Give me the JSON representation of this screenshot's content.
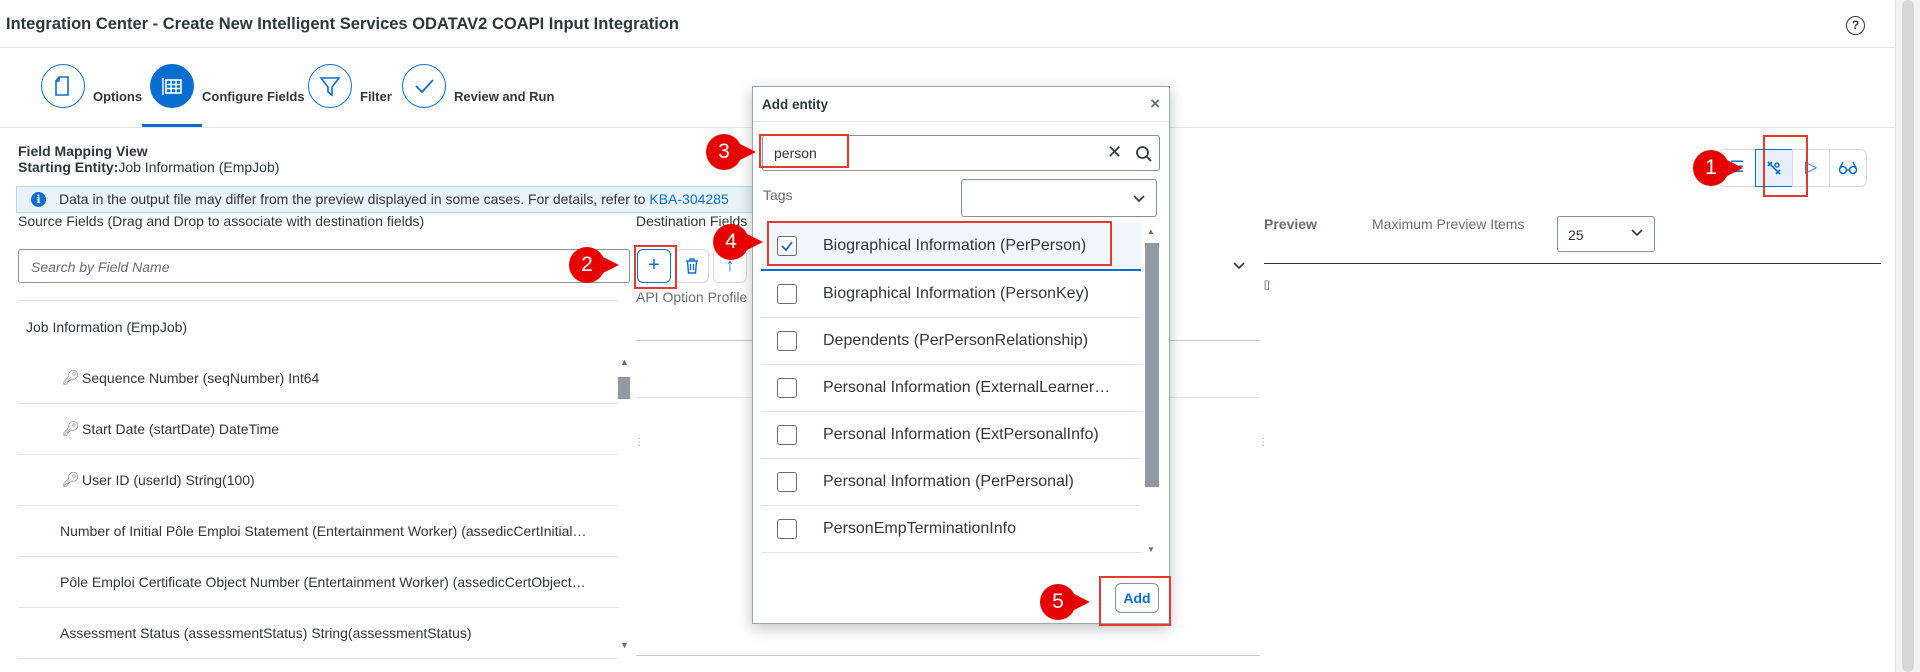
{
  "header": {
    "title": "Integration Center - Create New Intelligent Services ODATAV2 COAPI Input Integration",
    "help_glyph": "?"
  },
  "steps": [
    {
      "label": "Options",
      "icon": "document-icon"
    },
    {
      "label": "Configure Fields",
      "icon": "grid-icon",
      "active": true
    },
    {
      "label": "Filter",
      "icon": "filter-icon"
    },
    {
      "label": "Review and Run",
      "icon": "checkmark-icon"
    }
  ],
  "field_mapping": {
    "title": "Field Mapping View",
    "entity_label": "Starting Entity:",
    "entity_value": "Job Information (EmpJob)",
    "info_text": "Data in the output file may differ from the preview displayed in some cases. For details, refer to ",
    "info_link": "KBA-304285"
  },
  "source": {
    "header": "Source Fields (Drag and Drop to associate with destination fields)",
    "search_placeholder": "Search by Field Name",
    "table_title": "Job Information (EmpJob)",
    "rows": [
      {
        "text": "Sequence Number (seqNumber) Int64",
        "key": true
      },
      {
        "text": "Start Date (startDate) DateTime",
        "key": true
      },
      {
        "text": "User ID (userId) String(100)",
        "key": true
      },
      {
        "text": "Number of Initial Pôle Emploi Statement (Entertainment Worker) (assedicCertInitial…",
        "key": false
      },
      {
        "text": "Pôle Emploi Certificate Object Number (Entertainment Worker) (assedicCertObject…",
        "key": false
      },
      {
        "text": "Assessment Status (assessmentStatus) String(assessmentStatus)",
        "key": false
      }
    ]
  },
  "destination": {
    "header": "Destination Fields",
    "api_label": "API Option Profile"
  },
  "preview": {
    "title": "Preview",
    "max_label": "Maximum Preview Items",
    "max_value": "25",
    "empty": "[]"
  },
  "dialog": {
    "title": "Add entity",
    "search_value": "person",
    "tags_label": "Tags",
    "items": [
      {
        "label": "Biographical Information (PerPerson)",
        "checked": true
      },
      {
        "label": "Biographical Information (PersonKey)",
        "checked": false
      },
      {
        "label": "Dependents (PerPersonRelationship)",
        "checked": false
      },
      {
        "label": "Personal Information (ExternalLearner…",
        "checked": false
      },
      {
        "label": "Personal Information (ExtPersonalInfo)",
        "checked": false
      },
      {
        "label": "Personal Information (PerPersonal)",
        "checked": false
      },
      {
        "label": "PersonEmpTerminationInfo",
        "checked": false
      }
    ],
    "add_label": "Add"
  },
  "callouts": [
    "1",
    "2",
    "3",
    "4",
    "5"
  ],
  "colors": {
    "accent": "#0a6ed1",
    "callout": "#e60000",
    "highlight": "#e03c31"
  }
}
